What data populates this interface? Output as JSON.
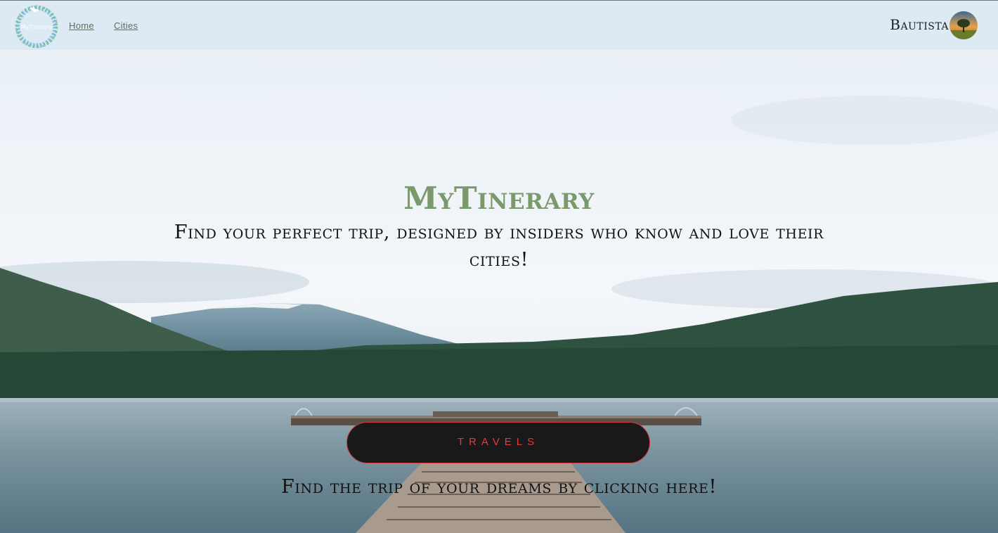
{
  "navbar": {
    "logo_text": "MyTinerary",
    "links": [
      "Home",
      "Cities"
    ],
    "user_name": "Bautista"
  },
  "hero": {
    "title": "MyTinerary",
    "subtitle": "Find your perfect trip, designed by insiders who know and love their cities!",
    "button_label": "TRAVELS",
    "cta_text": "Find the trip of your dreams by clicking here!"
  },
  "colors": {
    "navbar_bg": "#dde9f3",
    "title_green": "#7b9a6b",
    "button_bg": "#191919",
    "button_accent": "#e23a3a"
  },
  "icons": {
    "logo": "mytinerary-logo-icon",
    "avatar": "user-avatar-tree-icon"
  }
}
